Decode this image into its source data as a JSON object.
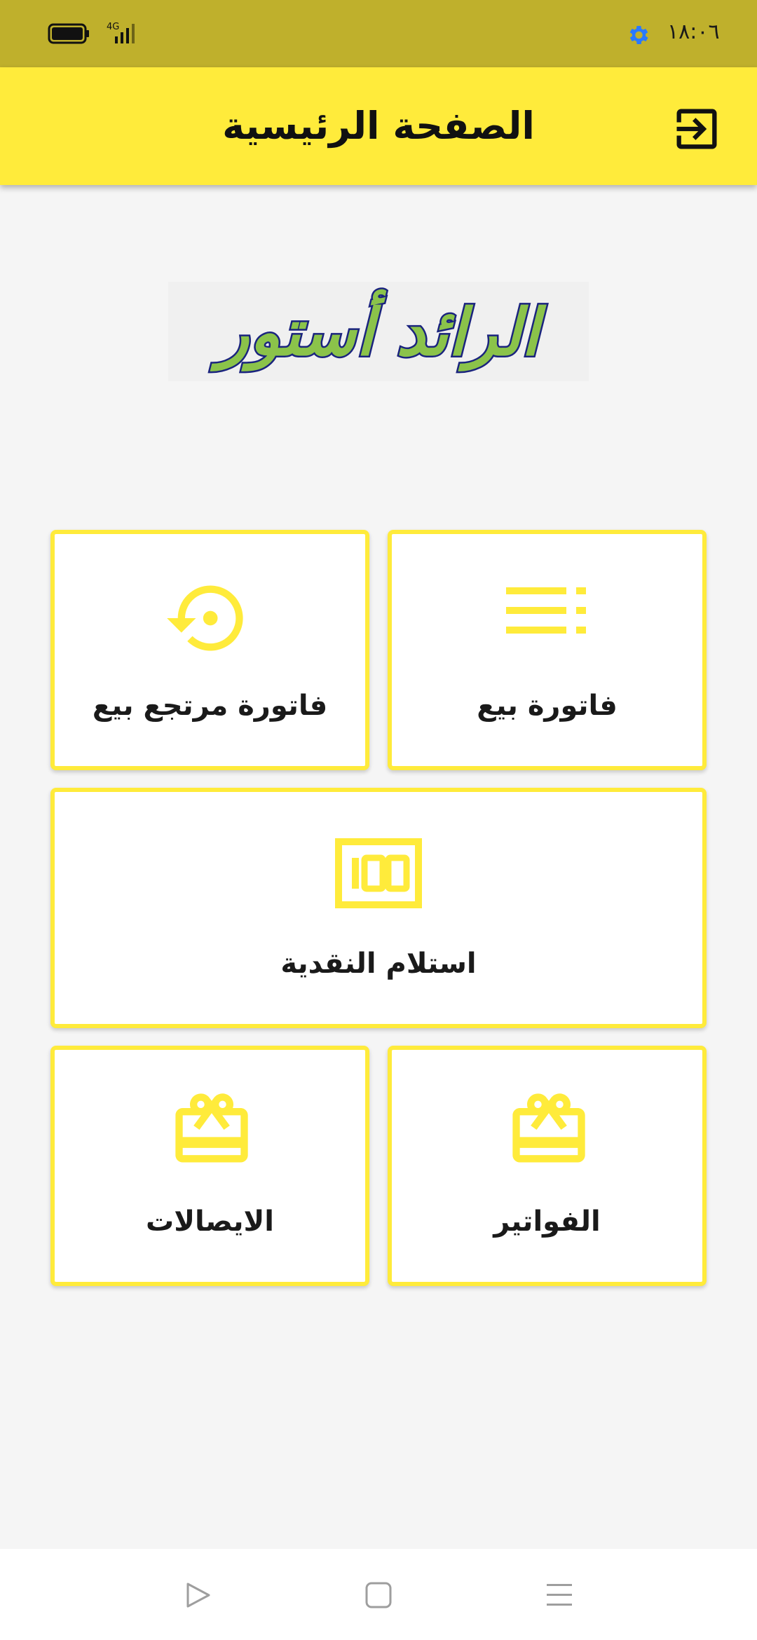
{
  "status_bar": {
    "time": "١٨:٠٦",
    "network": "4G"
  },
  "app_bar": {
    "title": "الصفحة الرئيسية",
    "exit_icon": "exit-to-app-icon"
  },
  "logo": {
    "text": "الرائد أستور"
  },
  "menu": [
    {
      "label": "فاتورة بيع",
      "icon": "list-icon"
    },
    {
      "label": "فاتورة مرتجع بيع",
      "icon": "restore-icon"
    },
    {
      "label": "استلام النقدية",
      "icon": "cash-100-icon"
    },
    {
      "label": "الفواتير",
      "icon": "gift-card-icon"
    },
    {
      "label": "الايصالات",
      "icon": "gift-card-icon"
    }
  ],
  "nav_bar": {
    "icons": [
      "back-triangle-icon",
      "home-square-icon",
      "menu-lines-icon"
    ]
  },
  "colors": {
    "accent": "#ffeb3b",
    "status_bar": "#bfb02c",
    "logo_fill": "#8bc34a",
    "logo_outline": "#1a237e"
  }
}
